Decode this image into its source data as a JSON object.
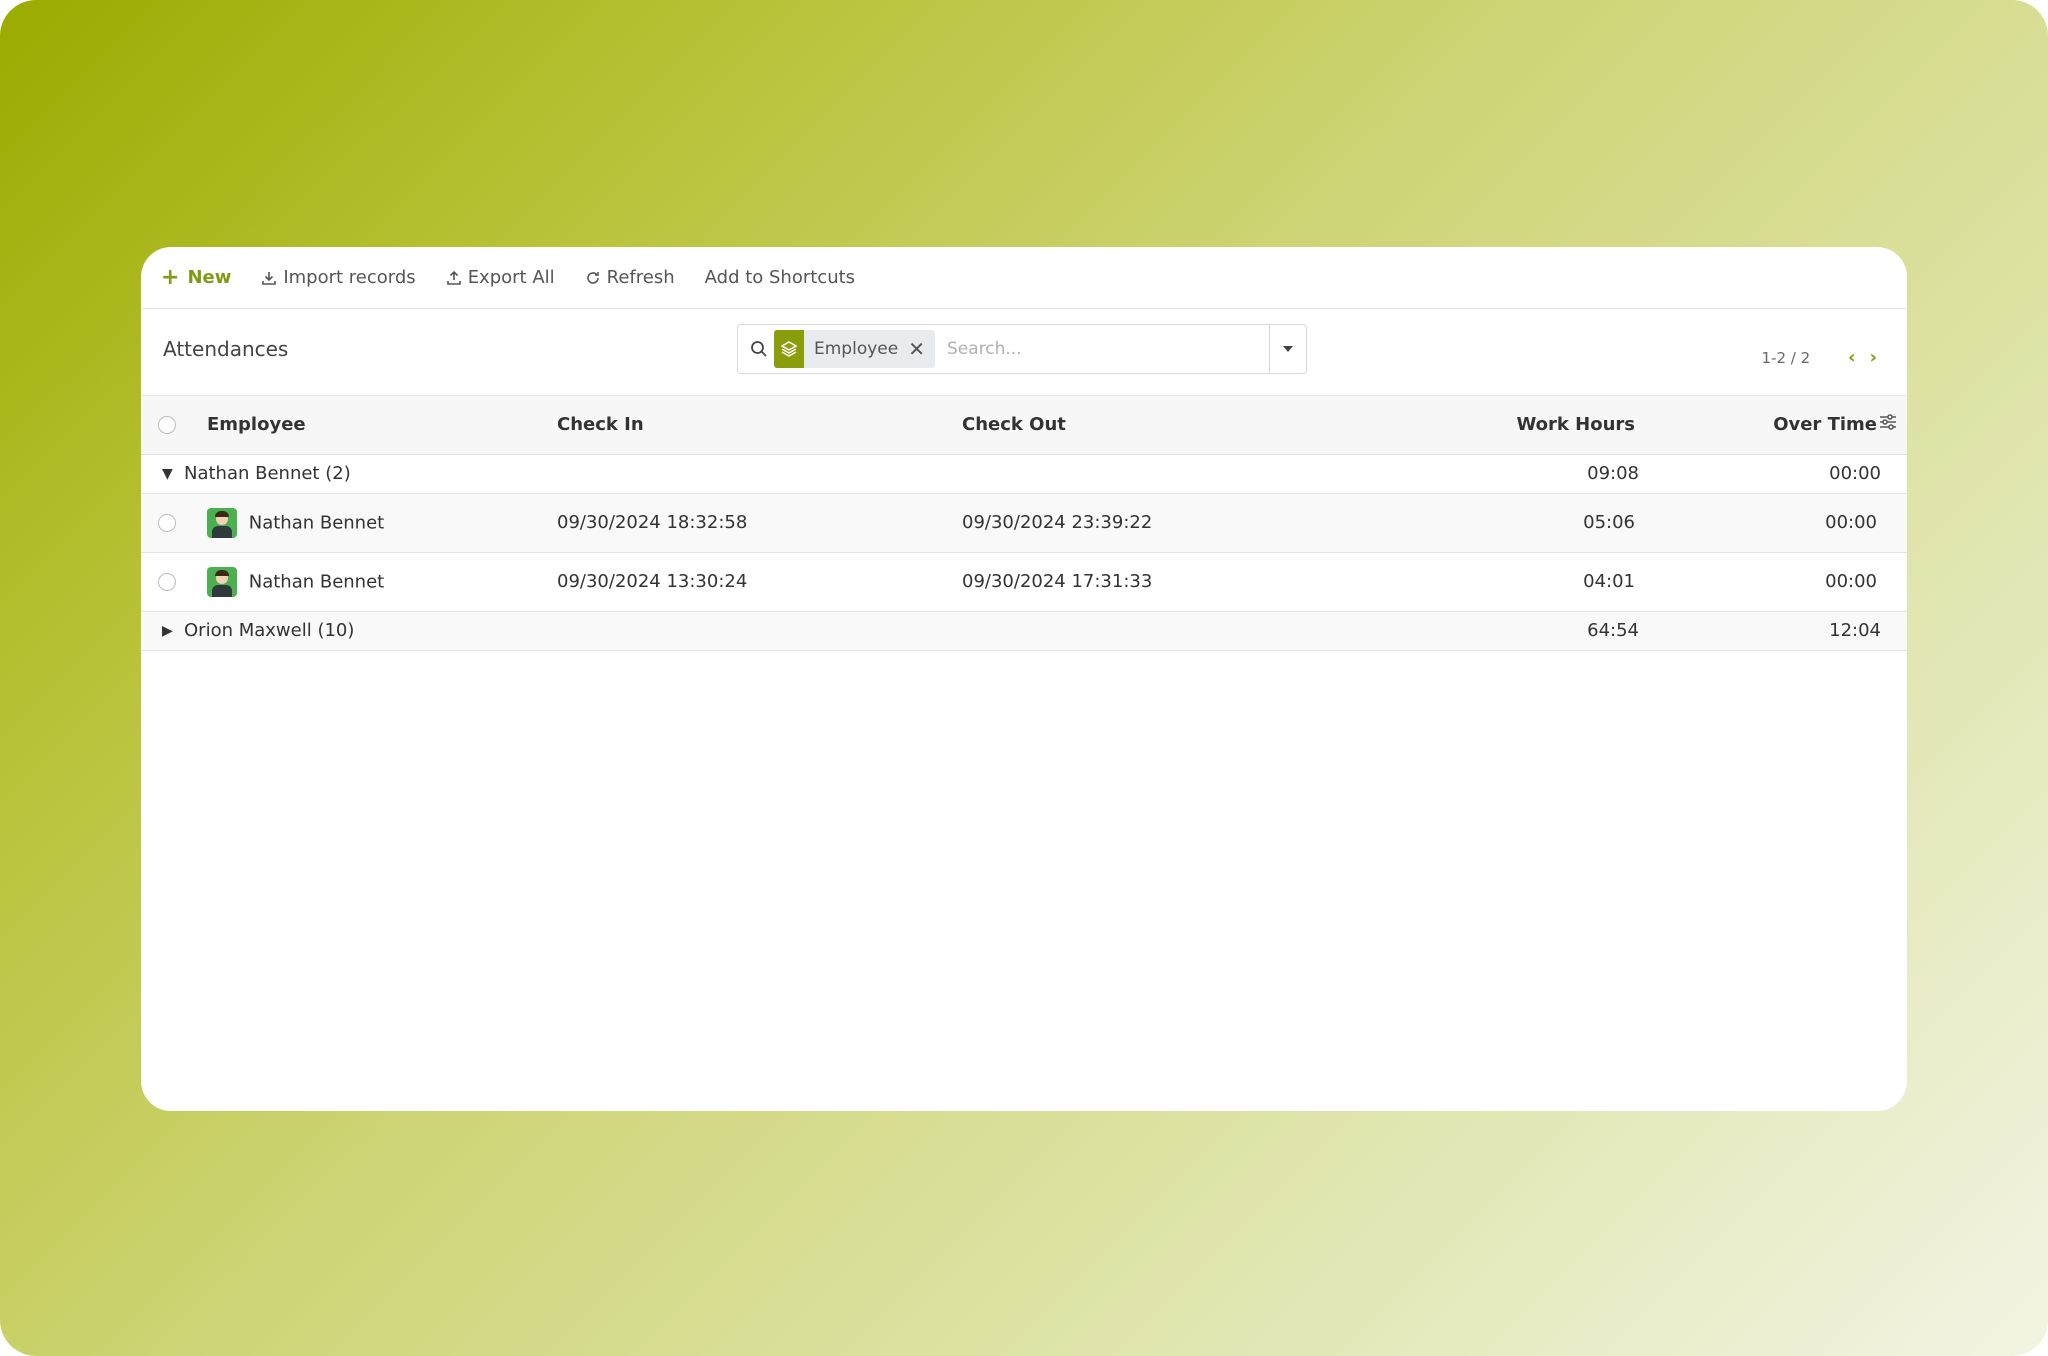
{
  "toolbar": {
    "new_label": "New",
    "import_label": "Import records",
    "export_label": "Export All",
    "refresh_label": "Refresh",
    "shortcuts_label": "Add to Shortcuts"
  },
  "page": {
    "title": "Attendances"
  },
  "search": {
    "facet_label": "Employee",
    "facet_close": "✕",
    "placeholder": "Search..."
  },
  "pager": {
    "value": "1-2 / 2",
    "prev": "‹",
    "next": "›"
  },
  "table": {
    "columns": {
      "employee": "Employee",
      "check_in": "Check In",
      "check_out": "Check Out",
      "work_hours": "Work Hours",
      "over_time": "Over Time"
    },
    "groups": [
      {
        "label": "Nathan Bennet (2)",
        "work_hours": "09:08",
        "over_time": "00:00",
        "expanded": true,
        "rows": [
          {
            "employee": "Nathan Bennet",
            "check_in": "09/30/2024 18:32:58",
            "check_out": "09/30/2024 23:39:22",
            "work_hours": "05:06",
            "over_time": "00:00"
          },
          {
            "employee": "Nathan Bennet",
            "check_in": "09/30/2024 13:30:24",
            "check_out": "09/30/2024 17:31:33",
            "work_hours": "04:01",
            "over_time": "00:00"
          }
        ]
      },
      {
        "label": "Orion Maxwell (10)",
        "work_hours": "64:54",
        "over_time": "12:04",
        "expanded": false
      }
    ]
  },
  "colors": {
    "accent": "#7f9a13",
    "facet_icon_bg": "#8a9e0c"
  },
  "icons": {
    "new": "plus-icon",
    "import": "download-icon",
    "export": "upload-icon",
    "refresh": "refresh-icon",
    "search": "search-icon",
    "facet": "layers-icon",
    "toggle": "caret-down-icon",
    "settings": "sliders-icon"
  }
}
